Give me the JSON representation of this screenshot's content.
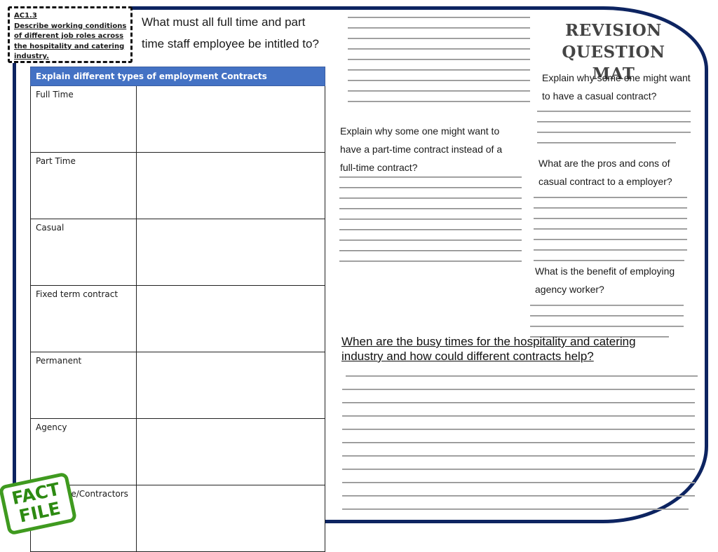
{
  "header": {
    "ac_code": "AC1.3",
    "ac_description": "Describe working conditions of different job roles across the hospitality and catering industry.",
    "title_line1": "REVISION",
    "title_line2": "QUESTION MAT"
  },
  "questions": {
    "entitled": {
      "line1": "What must all full time and part",
      "line2": "time staff employee be intitled to?"
    },
    "casual_why": {
      "line1": "Explain why some one might want",
      "line2": "to have a casual contract?"
    },
    "part_time_why": {
      "line1": "Explain why some one might want to",
      "line2": "have a part-time contract instead of a",
      "line3": "full-time contract?"
    },
    "casual_pros_cons": {
      "line1": "What are the pros and cons of",
      "line2": "casual contract to a employer?"
    },
    "agency_benefit": {
      "line1": "What is the benefit of employing",
      "line2": "agency worker?"
    },
    "busy_times": {
      "line1": "When are the busy times for the hospitality and catering",
      "line2": "industry and how could different contracts help?"
    }
  },
  "contracts_table": {
    "header": "Explain different types of employment Contracts",
    "rows": [
      {
        "label": "Full Time",
        "answer": ""
      },
      {
        "label": "Part Time",
        "answer": ""
      },
      {
        "label": "Casual",
        "answer": ""
      },
      {
        "label": "Fixed term contract",
        "answer": ""
      },
      {
        "label": "Permanent",
        "answer": ""
      },
      {
        "label": "Agency",
        "answer": ""
      },
      {
        "label": "Freelance/Contractors",
        "answer": ""
      }
    ]
  },
  "badge": {
    "line1": "FACT",
    "line2": "FILE"
  },
  "colors": {
    "frame": "#0d2461",
    "table_header": "#4472c4",
    "badge_green": "#3f9a1f",
    "title_gray": "#444444"
  }
}
